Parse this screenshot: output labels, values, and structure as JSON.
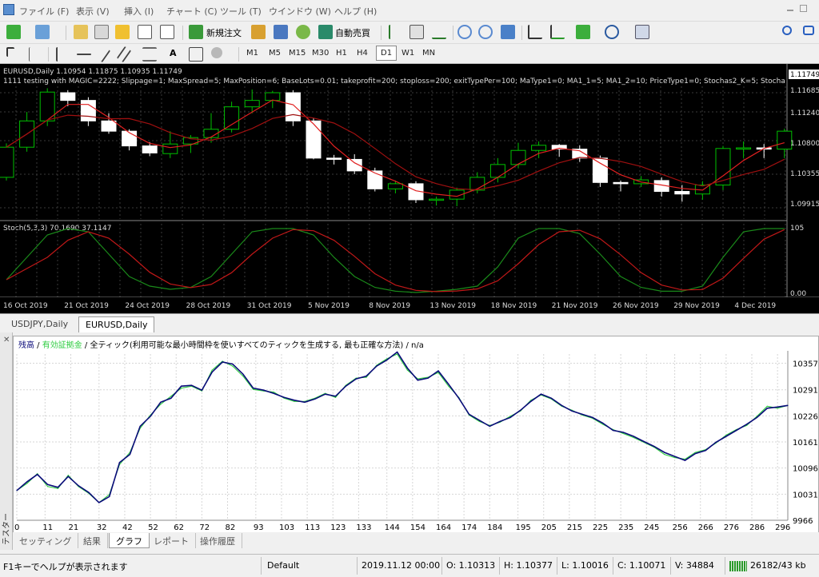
{
  "menu": {
    "items": [
      "ファイル (F)",
      "表示 (V)",
      "挿入 (I)",
      "チャート (C)",
      "ツール (T)",
      "ウインドウ (W)",
      "ヘルプ (H)"
    ]
  },
  "toolbar": {
    "new_order_label": "新規注文",
    "auto_trading_label": "自動売買",
    "timeframes": [
      "M1",
      "M5",
      "M15",
      "M30",
      "H1",
      "H4",
      "D1",
      "W1",
      "MN"
    ],
    "active_timeframe": "D1",
    "text_tool": "A"
  },
  "chart": {
    "symbol_line": "EURUSD,Daily  1.10954 1.11875 1.10935 1.11749",
    "ea_line": "1111 testing with MAGIC=2222; Slippage=1; MaxSpread=5; MaxPosition=6; BaseLots=0.01; takeprofit=200; stoploss=200; exitTypePer=100; MaType1=0; MA1_1=5; MA1_2=10; PriceType1=0; Stochas2_K=5; Stocha",
    "price_labels": [
      "1.11749",
      "1.11685",
      "1.11240",
      "1.10800",
      "1.10355",
      "1.09915"
    ],
    "current_price": "1.11749",
    "stoch_label": "Stoch(5,3,3) 70.1690 37.1147",
    "stoch_labels": [
      "105",
      "0.00"
    ],
    "date_labels": [
      "16 Oct 2019",
      "21 Oct 2019",
      "24 Oct 2019",
      "28 Oct 2019",
      "31 Oct 2019",
      "5 Nov 2019",
      "8 Nov 2019",
      "13 Nov 2019",
      "18 Nov 2019",
      "21 Nov 2019",
      "26 Nov 2019",
      "29 Nov 2019",
      "4 Dec 2019"
    ],
    "colors": {
      "background": "#000000",
      "bull": "#00c000",
      "bear": "#ffffff",
      "ma_fast": "#e02020",
      "ma_slow": "#a01010",
      "stoch_main": "#1a8a1a",
      "stoch_signal": "#c01818"
    }
  },
  "chart_tabs": [
    {
      "label": "USDJPY,Daily",
      "active": false
    },
    {
      "label": "EURUSD,Daily",
      "active": true
    }
  ],
  "tester": {
    "side_label": "テスター",
    "legend": {
      "balance": "残高",
      "sep1": " / ",
      "equity": "有効証拠金",
      "sep2": " / 全ティック(利用可能な最小時間枠を使いすべてのティックを生成する, 最も正確な方法) / n/a"
    },
    "colors": {
      "balance": "#0a0a7a",
      "equity": "#2ecc40"
    },
    "tabs": [
      {
        "label": "セッティング",
        "active": false
      },
      {
        "label": "結果",
        "active": false
      },
      {
        "label": "グラフ",
        "active": true
      },
      {
        "label": "レポート",
        "active": false
      },
      {
        "label": "操作履歴",
        "active": false
      }
    ],
    "chart_data": {
      "type": "line",
      "ylim": [
        9966,
        10380
      ],
      "y_ticks": [
        "10357",
        "10291",
        "10226",
        "10161",
        "10096",
        "10031",
        "9966"
      ],
      "x_ticks": [
        "0",
        "11",
        "21",
        "32",
        "42",
        "52",
        "62",
        "72",
        "82",
        "93",
        "103",
        "113",
        "123",
        "133",
        "144",
        "154",
        "164",
        "174",
        "184",
        "195",
        "205",
        "215",
        "225",
        "235",
        "245",
        "256",
        "266",
        "276",
        "286",
        "296"
      ],
      "series": [
        {
          "name": "残高",
          "x": [
            0,
            4,
            8,
            12,
            16,
            20,
            24,
            28,
            32,
            36,
            40,
            44,
            48,
            52,
            56,
            60,
            64,
            68,
            72,
            76,
            80,
            84,
            88,
            92,
            96,
            100,
            104,
            108,
            112,
            116,
            120,
            124,
            128,
            132,
            136,
            140,
            144,
            148,
            152,
            156,
            160,
            164,
            168,
            172,
            176,
            180,
            184,
            188,
            192,
            196,
            200,
            204,
            208,
            212,
            216,
            220,
            224,
            228,
            232,
            236,
            240,
            244,
            248,
            252,
            256,
            260,
            264,
            268,
            272,
            276,
            280,
            284,
            288,
            292,
            296,
            300
          ],
          "values": [
            10040,
            10062,
            10080,
            10055,
            10048,
            10075,
            10052,
            10035,
            10010,
            10025,
            10110,
            10130,
            10200,
            10225,
            10260,
            10270,
            10300,
            10302,
            10290,
            10335,
            10360,
            10355,
            10330,
            10295,
            10290,
            10282,
            10272,
            10265,
            10260,
            10268,
            10280,
            10275,
            10300,
            10318,
            10325,
            10350,
            10365,
            10385,
            10345,
            10315,
            10320,
            10338,
            10305,
            10270,
            10230,
            10215,
            10200,
            10212,
            10222,
            10240,
            10262,
            10280,
            10270,
            10252,
            10238,
            10230,
            10222,
            10208,
            10190,
            10185,
            10175,
            10162,
            10150,
            10135,
            10125,
            10115,
            10132,
            10140,
            10160,
            10175,
            10190,
            10205,
            10222,
            10245,
            10248,
            10252
          ]
        },
        {
          "name": "有効証拠金",
          "x": [
            0,
            4,
            8,
            12,
            16,
            20,
            24,
            28,
            32,
            36,
            40,
            44,
            48,
            52,
            56,
            60,
            64,
            68,
            72,
            76,
            80,
            84,
            88,
            92,
            96,
            100,
            104,
            108,
            112,
            116,
            120,
            124,
            128,
            132,
            136,
            140,
            144,
            148,
            152,
            156,
            160,
            164,
            168,
            172,
            176,
            180,
            184,
            188,
            192,
            196,
            200,
            204,
            208,
            212,
            216,
            220,
            224,
            228,
            232,
            236,
            240,
            244,
            248,
            252,
            256,
            260,
            264,
            268,
            272,
            276,
            280,
            284,
            288,
            292,
            296,
            300
          ],
          "values": [
            10040,
            10058,
            10082,
            10050,
            10045,
            10078,
            10050,
            10033,
            10010,
            10030,
            10105,
            10135,
            10195,
            10228,
            10255,
            10275,
            10295,
            10300,
            10288,
            10340,
            10362,
            10350,
            10325,
            10292,
            10288,
            10285,
            10270,
            10262,
            10262,
            10270,
            10282,
            10272,
            10302,
            10320,
            10322,
            10352,
            10368,
            10380,
            10340,
            10318,
            10322,
            10334,
            10300,
            10272,
            10228,
            10212,
            10202,
            10210,
            10225,
            10238,
            10265,
            10278,
            10268,
            10250,
            10240,
            10228,
            10220,
            10205,
            10192,
            10182,
            10172,
            10160,
            10148,
            10130,
            10122,
            10118,
            10135,
            10142,
            10158,
            10178,
            10192,
            10202,
            10225,
            10250,
            10245,
            10252
          ]
        }
      ]
    }
  },
  "status": {
    "help": "F1キーでヘルプが表示されます",
    "profile": "Default",
    "datetime": "2019.11.12 00:00",
    "open": "O: 1.10313",
    "high": "H: 1.10377",
    "low": "L: 1.10016",
    "close": "C: 1.10071",
    "volume": "V: 34884",
    "traffic": "26182/43 kb"
  }
}
